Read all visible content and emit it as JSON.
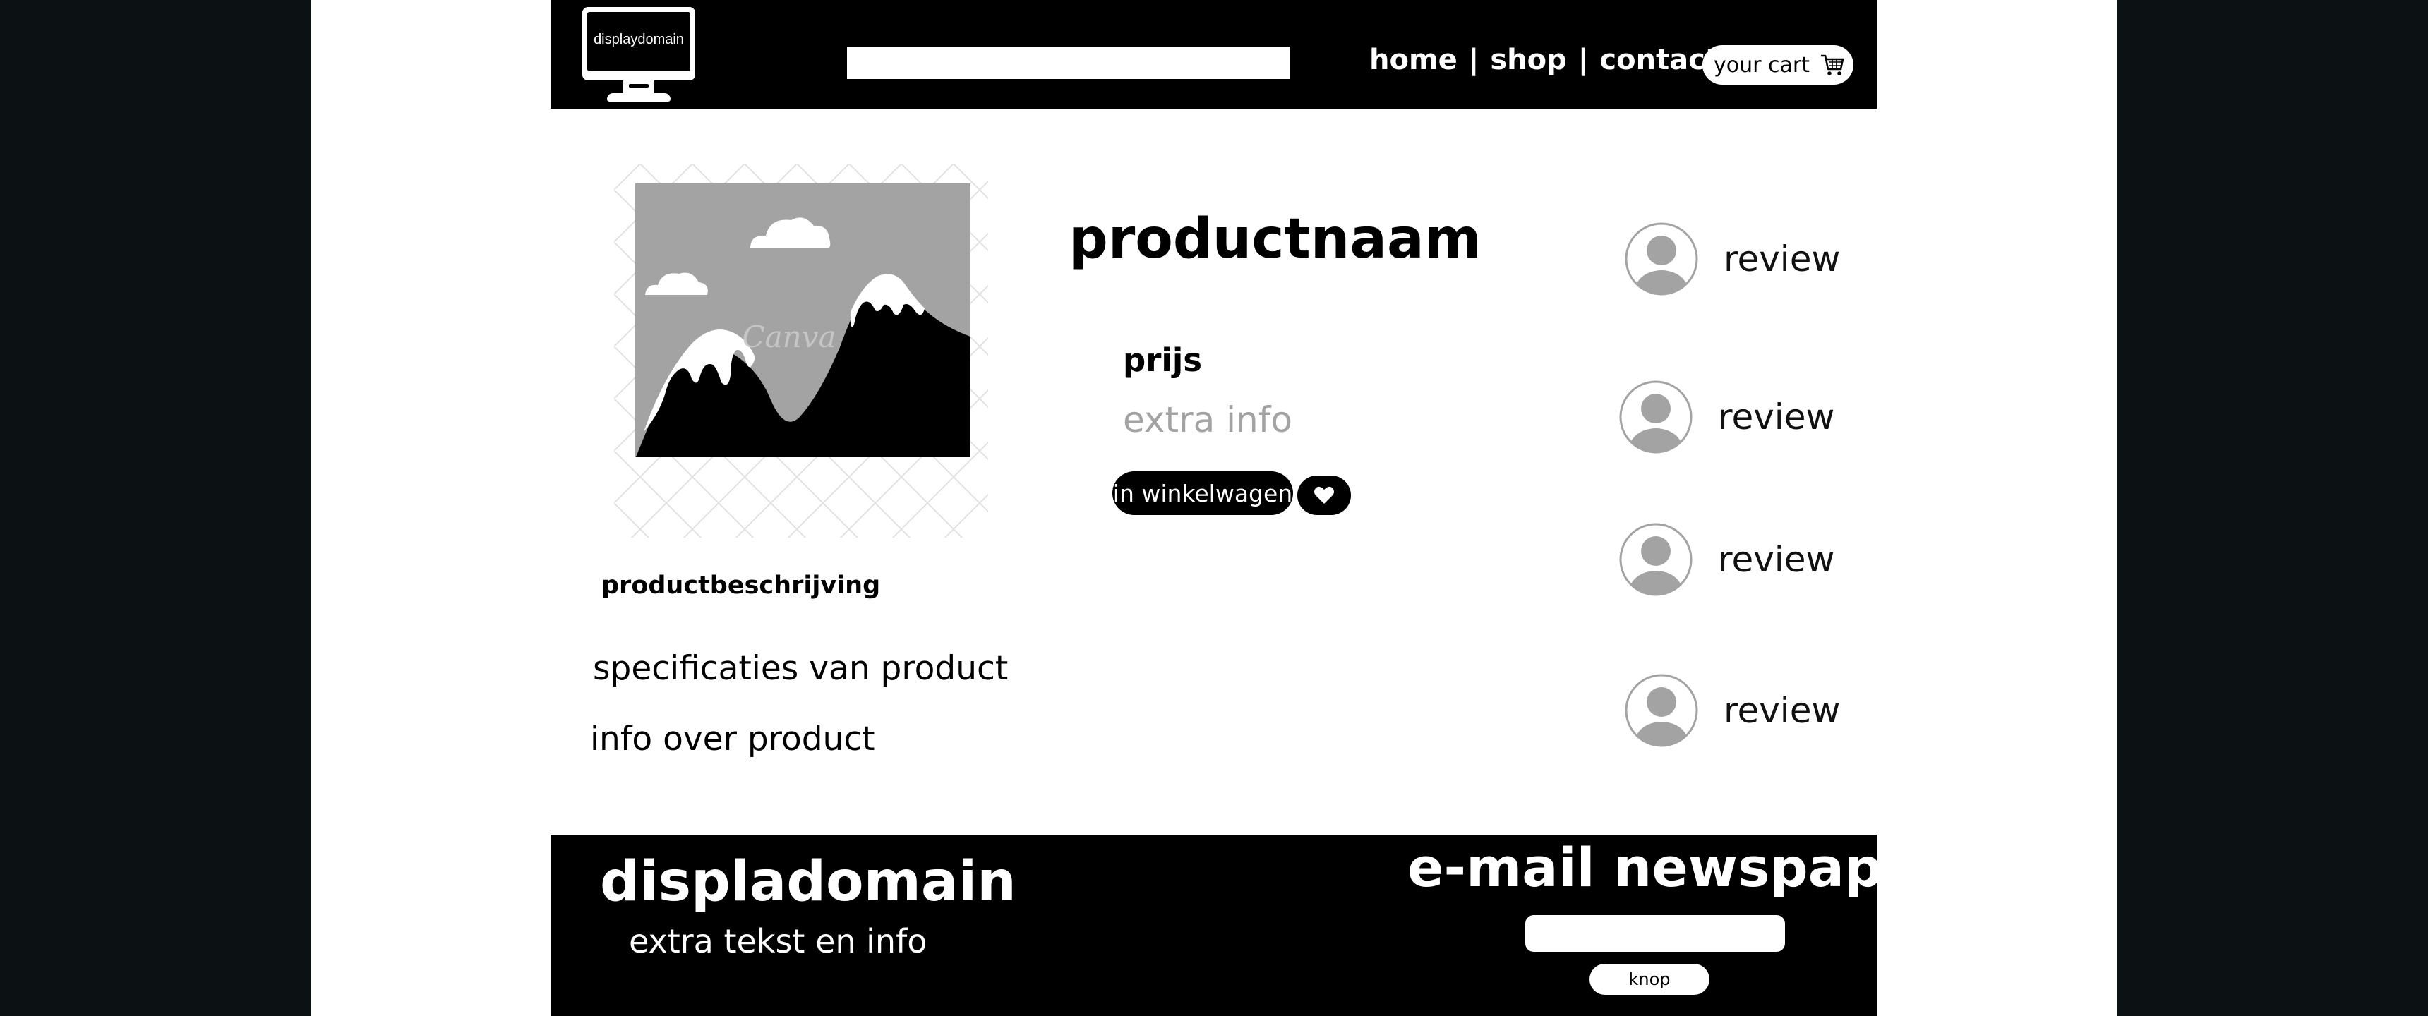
{
  "header": {
    "logo_text": "displaydomain",
    "search": {
      "value": "",
      "placeholder": ""
    },
    "nav": [
      {
        "label": "home"
      },
      {
        "label": "shop"
      },
      {
        "label": "contact"
      }
    ],
    "separator": "|",
    "cart_label": "your cart"
  },
  "product": {
    "name": "productnaam",
    "price": "prijs",
    "extra_info": "extra info",
    "add_to_cart_label": "in winkelwagen",
    "image_watermark": "Canva",
    "description_title": "productbeschrijving",
    "specs": "specificaties van product",
    "info": "info over product"
  },
  "reviews": [
    {
      "label": "review"
    },
    {
      "label": "review"
    },
    {
      "label": "review"
    },
    {
      "label": "review"
    }
  ],
  "footer": {
    "brand": "displadomain",
    "subtitle": "extra tekst en info",
    "newsletter_title": "e-mail newspaper",
    "newsletter_input": {
      "value": "",
      "placeholder": ""
    },
    "newsletter_button": "knop"
  },
  "icons": {
    "cart": "cart-icon",
    "favorite": "heart-icon",
    "avatar": "user-avatar-icon",
    "logo": "monitor-icon"
  },
  "colors": {
    "background": "#0c1114",
    "page": "#ffffff",
    "bar": "#000000",
    "muted": "#a3a3a3"
  }
}
